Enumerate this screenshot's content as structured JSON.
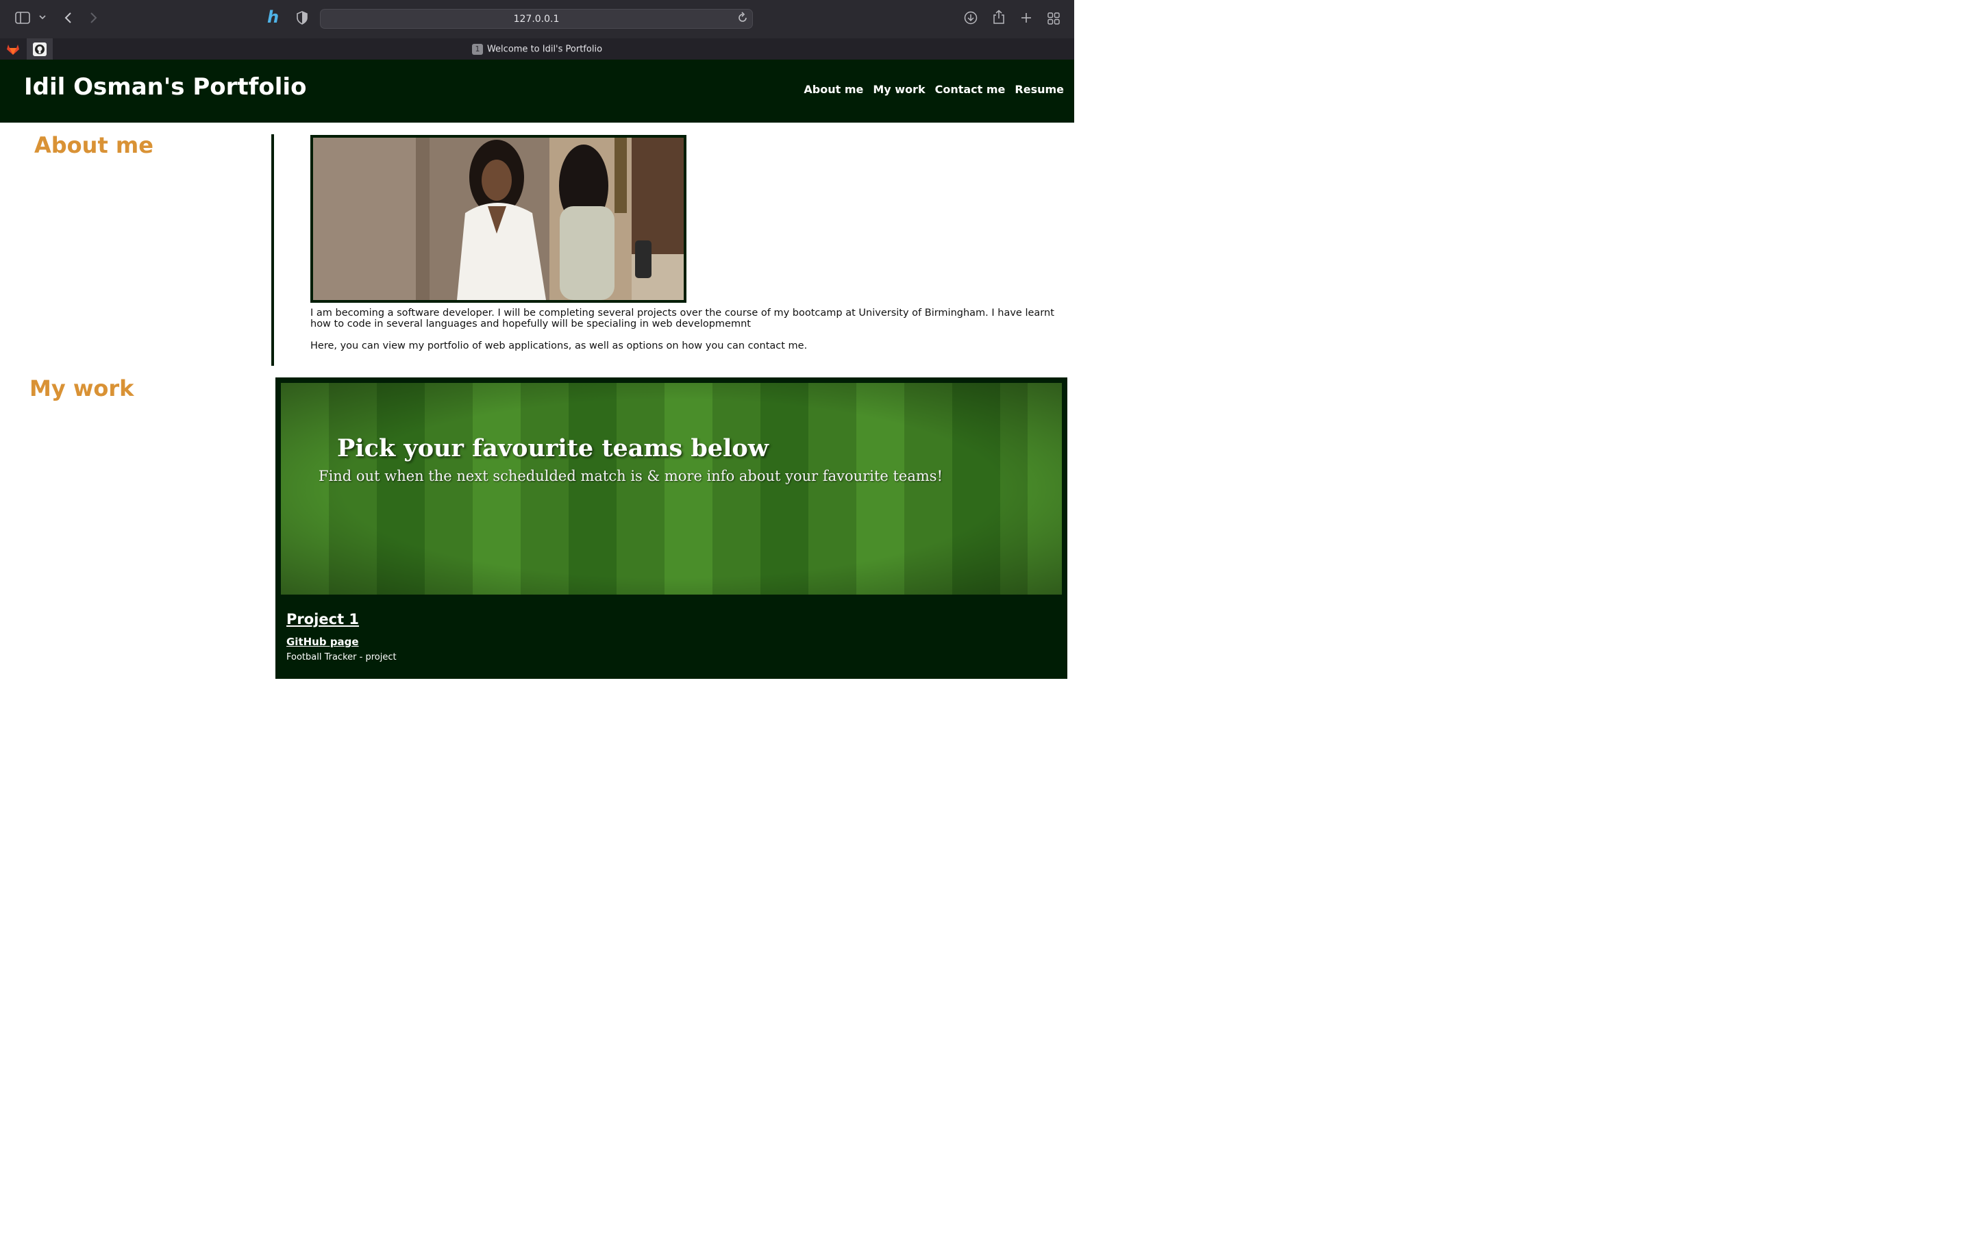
{
  "browser": {
    "url": "127.0.0.1",
    "tab_title": "Welcome to Idil's Portfolio",
    "tab_badge": "1",
    "icons": {
      "sidebar": "sidebar-icon",
      "chevron": "chevron-down-icon",
      "back": "back-icon",
      "forward": "forward-icon",
      "extension": "honey-extension-icon",
      "privacy": "shield-icon",
      "reload": "reload-icon",
      "download": "download-icon",
      "share": "share-icon",
      "new_tab": "plus-icon",
      "tab_overview": "grid-icon"
    }
  },
  "header": {
    "title": "Idil Osman's Portfolio",
    "nav": [
      "About me",
      "My work",
      "Contact me",
      "Resume"
    ]
  },
  "about": {
    "heading": "About me",
    "paragraph1": "I am becoming a software developer. I will be completing several projects over the course of my bootcamp at University of Birmingham. I have learnt how to code in several languages and hopefully will be specialing in web developmemnt",
    "paragraph2": "Here, you can view my portfolio of web applications, as well as options on how you can contact me."
  },
  "work": {
    "heading": "My work",
    "banner_title": "Pick your favourite teams below",
    "banner_subtitle": "Find out when the next schedulded match is & more info about your favourite teams!",
    "project_title": "Project 1",
    "project_link": "GitHub page",
    "project_desc": "Football Tracker - project"
  },
  "colors": {
    "header_bg": "#001d05",
    "accent": "#d99235",
    "text": "#111111"
  }
}
